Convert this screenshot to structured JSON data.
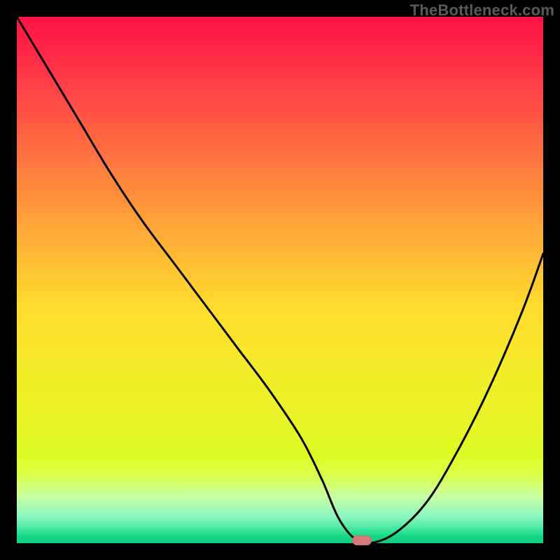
{
  "watermark": "TheBottleneck.com",
  "chart_data": {
    "type": "line",
    "title": "",
    "xlabel": "",
    "ylabel": "",
    "xlim": [
      0,
      100
    ],
    "ylim": [
      0,
      100
    ],
    "grid": false,
    "series": [
      {
        "name": "bottleneck-curve",
        "x": [
          0,
          6,
          12,
          18,
          24,
          30,
          36,
          42,
          48,
          54,
          58,
          61,
          64,
          67,
          72,
          78,
          84,
          90,
          96,
          100
        ],
        "y": [
          100,
          90,
          80,
          70,
          61,
          53,
          45,
          37,
          29,
          20,
          12,
          5,
          1,
          0,
          2,
          8,
          18,
          30,
          44,
          55
        ]
      }
    ],
    "marker": {
      "x": 65.5,
      "y": 0.5,
      "shape": "pill",
      "color": "#d97a7a"
    },
    "background_gradient": {
      "stops": [
        {
          "pos": 0.0,
          "color": "#ff1244"
        },
        {
          "pos": 0.5,
          "color": "#ffd12f"
        },
        {
          "pos": 0.88,
          "color": "#dcff3a"
        },
        {
          "pos": 1.0,
          "color": "#0bce7e"
        }
      ]
    }
  }
}
